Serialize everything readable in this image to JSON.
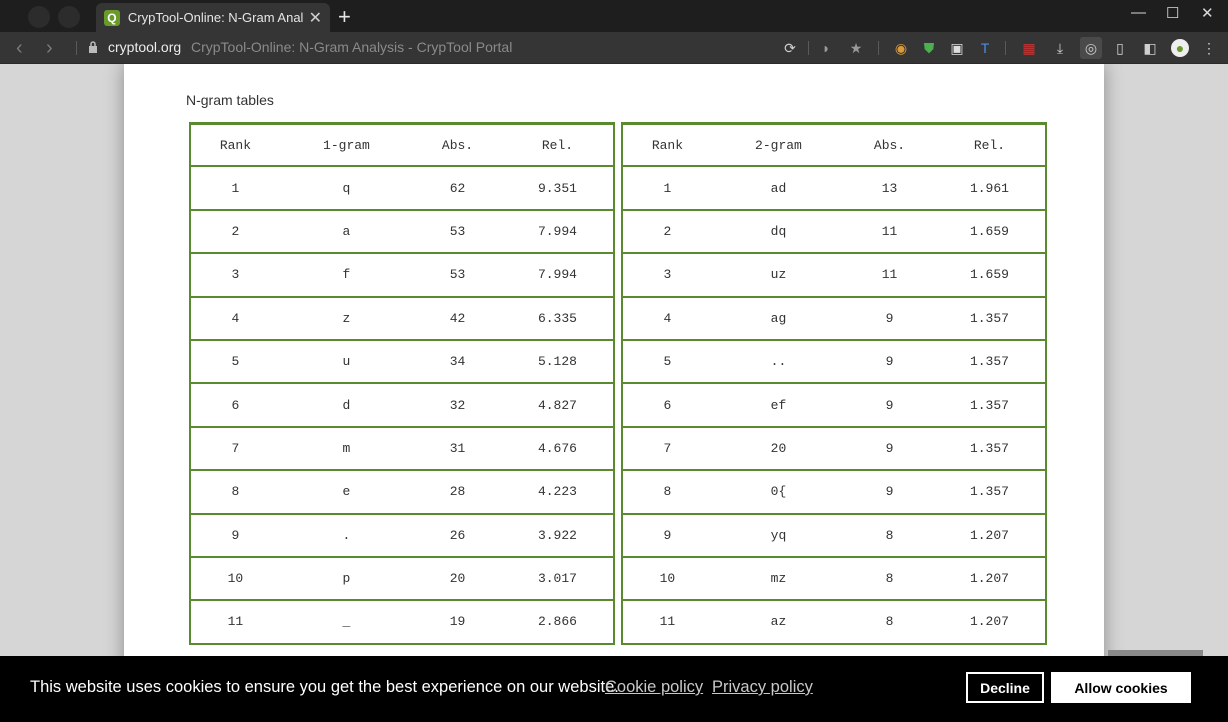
{
  "browser": {
    "tab_title": "CrypTool-Online: N-Gram Analy",
    "tab_favicon": "Q",
    "new_tab": "+",
    "url_host": "cryptool.org",
    "url_title": "CrypTool-Online: N-Gram Analysis - CrypTool Portal",
    "icons": [
      "reload-icon",
      "pocket-icon",
      "star-icon",
      "extension-icons",
      "download-icon",
      "screenshot-icon",
      "reader-icon",
      "sidebar-icon",
      "profile-icon",
      "menu-icon"
    ]
  },
  "page": {
    "section_title": "N-gram tables"
  },
  "table1": {
    "headers": [
      "Rank",
      "1-gram",
      "Abs.",
      "Rel."
    ],
    "rows": [
      [
        "1",
        "q",
        "62",
        "9.351"
      ],
      [
        "2",
        "a",
        "53",
        "7.994"
      ],
      [
        "3",
        "f",
        "53",
        "7.994"
      ],
      [
        "4",
        "z",
        "42",
        "6.335"
      ],
      [
        "5",
        "u",
        "34",
        "5.128"
      ],
      [
        "6",
        "d",
        "32",
        "4.827"
      ],
      [
        "7",
        "m",
        "31",
        "4.676"
      ],
      [
        "8",
        "e",
        "28",
        "4.223"
      ],
      [
        "9",
        ".",
        "26",
        "3.922"
      ],
      [
        "10",
        "p",
        "20",
        "3.017"
      ],
      [
        "11",
        "_",
        "19",
        "2.866"
      ]
    ]
  },
  "table2": {
    "headers": [
      "Rank",
      "2-gram",
      "Abs.",
      "Rel."
    ],
    "rows": [
      [
        "1",
        "ad",
        "13",
        "1.961"
      ],
      [
        "2",
        "dq",
        "11",
        "1.659"
      ],
      [
        "3",
        "uz",
        "11",
        "1.659"
      ],
      [
        "4",
        "ag",
        "9",
        "1.357"
      ],
      [
        "5",
        "..",
        "9",
        "1.357"
      ],
      [
        "6",
        "ef",
        "9",
        "1.357"
      ],
      [
        "7",
        "20",
        "9",
        "1.357"
      ],
      [
        "8",
        "0{",
        "9",
        "1.357"
      ],
      [
        "9",
        "yq",
        "8",
        "1.207"
      ],
      [
        "10",
        "mz",
        "8",
        "1.207"
      ],
      [
        "11",
        "az",
        "8",
        "1.207"
      ]
    ]
  },
  "cookie": {
    "message": "This website uses cookies to ensure you get the best experience on our website.",
    "cookie_policy": "Cookie policy",
    "privacy_policy": "Privacy policy",
    "decline": "Decline",
    "allow": "Allow cookies"
  }
}
